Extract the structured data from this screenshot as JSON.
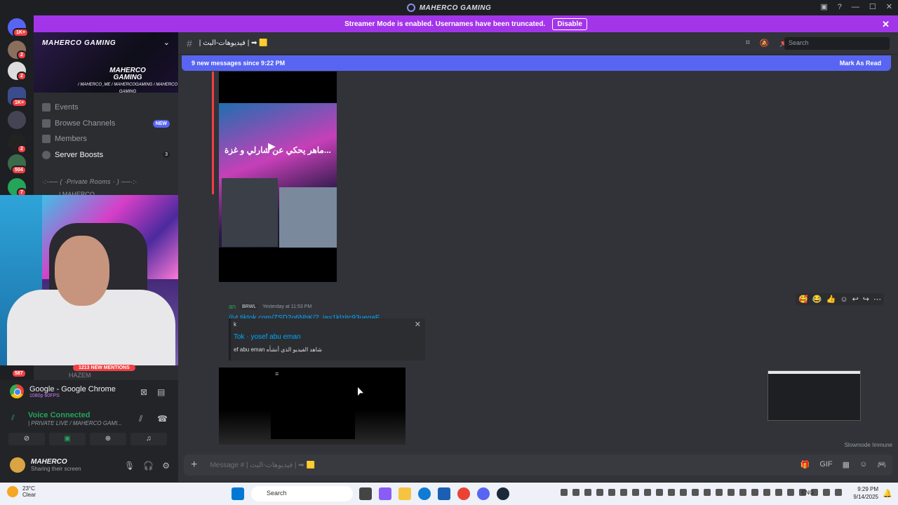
{
  "window": {
    "title": "MAHERCO GAMING"
  },
  "banner": {
    "text": "Streamer Mode is enabled. Usernames have been truncated.",
    "disable": "Disable"
  },
  "guilds": [
    {
      "badge": "1K+"
    },
    {
      "badge": "2"
    },
    {
      "badge": "2"
    },
    {
      "badge": "1K+"
    },
    {
      "badge": ""
    },
    {
      "badge": "2"
    },
    {
      "badge": "504"
    },
    {
      "badge": "7"
    }
  ],
  "server": {
    "name": "MAHERCO GAMING",
    "logo_line1": "MAHERCO",
    "logo_line2": "GAMING",
    "social": "/ MAHERCO_ME / MAHERCOGAMING / MAHERCO GAMING"
  },
  "nav": {
    "events": "Events",
    "browse": "Browse Channels",
    "new_badge": "NEW",
    "members": "Members",
    "boosts": "Server Boosts",
    "boosts_count": "3"
  },
  "category": "·:·── ( ·Private Rooms · ) ──·:·",
  "channel_user": "| MAHERCO",
  "panel": {
    "mentions": "1213 NEW MENTIONS",
    "hazem": "HAZEM",
    "badge587": "587",
    "stream_title": "Google - Google Chrome",
    "stream_sub": "1080p 60FPS",
    "voice": "Voice Connected",
    "voice_sub": "| PRIVATE LIVE / MAHERCO GAMI...",
    "username": "MAHERCO",
    "userstatus": "Sharing their screen"
  },
  "channel": {
    "name": "| فيديوهات-البث | ➡ 🟨",
    "search": "Search"
  },
  "newmsg": {
    "text": "9 new messages since 9:22 PM",
    "mark": "Mark As Read"
  },
  "video1": {
    "caption": "ماهر يحكي عن شارلي و غزة..."
  },
  "message": {
    "author": "an",
    "tag": "BRWL",
    "time": "Yesterday at 11:53 PM",
    "link": "//vt.tiktok.com/ZSD2o6NhK/?_ia=1klzitc93ueqaE"
  },
  "embed": {
    "provider": "k",
    "title": "Tok · yosef abu eman",
    "desc": "ef abu eman شاهد الفيديو الذي أنشأه"
  },
  "footer": {
    "slowmode": "Slowmode Immune",
    "placeholder": "Message # | فيديوهات-البث | ➡ 🟨"
  },
  "taskbar": {
    "temp": "23°C",
    "weather": "Clear",
    "search": "Search",
    "lang": "ENG",
    "time": "9:29 PM",
    "date": "9/14/2025"
  },
  "colors": {
    "accent": "#5865f2",
    "banner": "#a335e9",
    "online": "#23a55a",
    "mention": "#f23f43"
  }
}
